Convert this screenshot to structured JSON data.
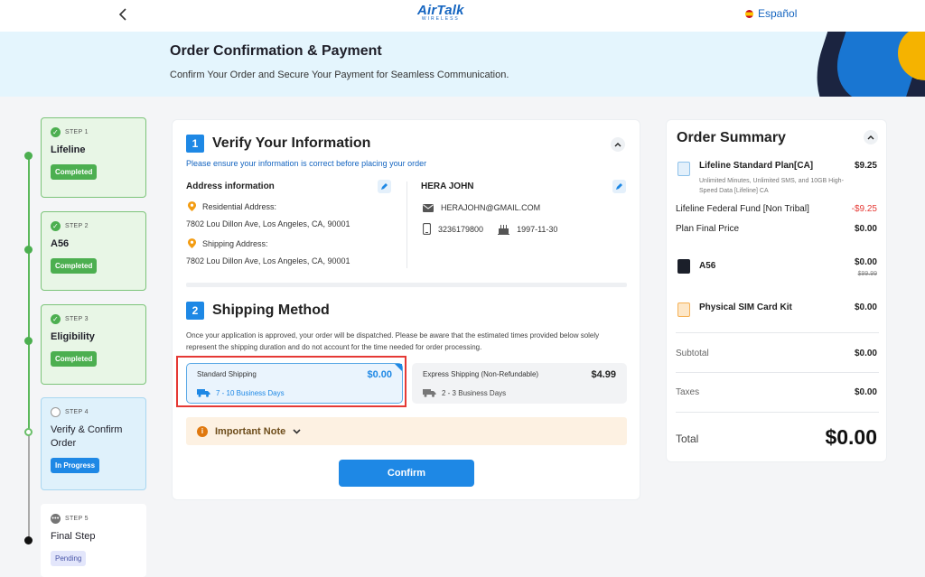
{
  "header": {
    "logo_text": "AirTalk",
    "logo_sub": "WIRELESS",
    "language": "Español"
  },
  "banner": {
    "title": "Order Confirmation & Payment",
    "subtitle": "Confirm Your Order and Secure Your Payment for Seamless Communication."
  },
  "steps": [
    {
      "num": "STEP 1",
      "name": "Lifeline",
      "status": "Completed"
    },
    {
      "num": "STEP 2",
      "name": "A56",
      "status": "Completed"
    },
    {
      "num": "STEP 3",
      "name": "Eligibility",
      "status": "Completed"
    },
    {
      "num": "STEP 4",
      "name": "Verify & Confirm Order",
      "status": "In Progress"
    },
    {
      "num": "STEP 5",
      "name": "Final Step",
      "status": "Pending"
    }
  ],
  "verify": {
    "number": "1",
    "title": "Verify Your Information",
    "hint": "Please ensure your information is correct before placing your order",
    "address_heading": "Address information",
    "residential_label": "Residential Address:",
    "residential_value": "7802 Lou Dillon Ave, Los Angeles, CA, 90001",
    "shipping_label": "Shipping Address:",
    "shipping_value": "7802 Lou Dillon Ave, Los Angeles, CA, 90001",
    "name": "HERA JOHN",
    "email": "HERAJOHN@GMAIL.COM",
    "phone": "3236179800",
    "dob": "1997-11-30"
  },
  "shipping": {
    "number": "2",
    "title": "Shipping Method",
    "description": "Once your application is approved, your order will be dispatched. Please be aware that the estimated times provided below solely represent the shipping duration and do not account for the time needed for order processing.",
    "options": [
      {
        "name": "Standard Shipping",
        "price": "$0.00",
        "time": "7 - 10 Business Days"
      },
      {
        "name": "Express Shipping (Non-Refundable)",
        "price": "$4.99",
        "time": "2 - 3 Business Days"
      }
    ],
    "note": "Important Note",
    "confirm": "Confirm"
  },
  "summary": {
    "title": "Order Summary",
    "plan_name": "Lifeline Standard Plan[CA]",
    "plan_price": "$9.25",
    "plan_detail": "Unlimited Minutes, Unlimited SMS, and 10GB High-Speed Data [Lifeline] CA",
    "fund_label": "Lifeline Federal Fund [Non Tribal]",
    "fund_value": "-$9.25",
    "final_label": "Plan Final Price",
    "final_value": "$0.00",
    "device_name": "A56",
    "device_price": "$0.00",
    "device_original": "$99.99",
    "sim_name": "Physical SIM Card Kit",
    "sim_price": "$0.00",
    "subtotal_label": "Subtotal",
    "subtotal_value": "$0.00",
    "taxes_label": "Taxes",
    "taxes_value": "$0.00",
    "total_label": "Total",
    "total_value": "$0.00"
  },
  "colors": {
    "accent": "#1e88e5",
    "success": "#4caf50",
    "discount": "#e53935",
    "highlight": "#e53935"
  }
}
